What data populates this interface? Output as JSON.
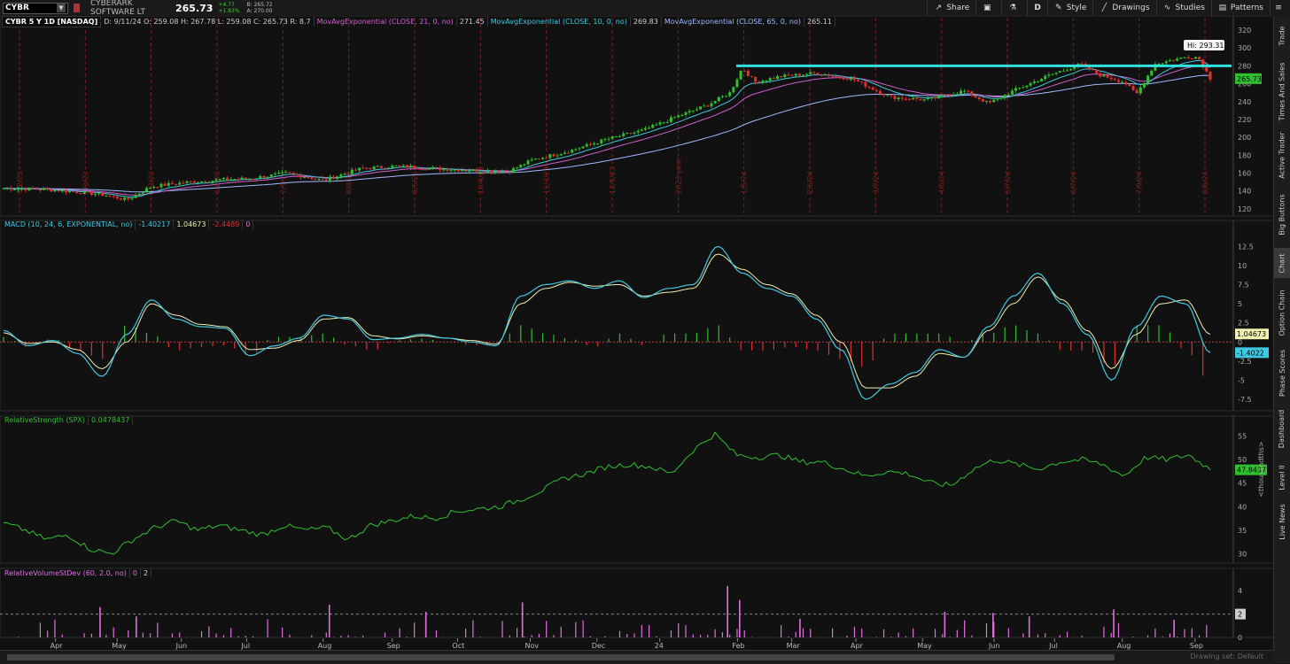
{
  "toolbar": {
    "symbol": "CYBR",
    "company": "CYBERARK SOFTWARE LT",
    "last": "265.73",
    "change_abs": "+4.77",
    "change_pct": "+1.83%",
    "bid": "B: 265.72",
    "ask": "A: 270.00",
    "buttons": [
      {
        "label": "Share",
        "icon": "share-icon"
      },
      {
        "label": "",
        "icon": "clipboard-icon"
      },
      {
        "label": "",
        "icon": "flask-icon"
      },
      {
        "label": "D",
        "icon": ""
      },
      {
        "label": "Style",
        "icon": "gear-icon"
      },
      {
        "label": "Drawings",
        "icon": "pencil-icon"
      },
      {
        "label": "Studies",
        "icon": "studies-icon"
      },
      {
        "label": "Patterns",
        "icon": "patterns-icon"
      }
    ]
  },
  "price_legend": {
    "title": "CYBR 5 Y 1D [NASDAQ]",
    "ohlc": "D: 9/11/24  O: 259.08  H: 267.78  L: 259.08  C: 265.73  R: 8.7",
    "ema21": "MovAvgExponential (CLOSE, 21, 0, no)",
    "ema21_val": "271.45",
    "ema10": "MovAvgExponential (CLOSE, 10, 0, no)",
    "ema10_val": "269.83",
    "ema65": "MovAvgExponential (CLOSE, 65, 0, no)",
    "ema65_val": "265.11"
  },
  "macd_legend": {
    "title": "MACD (10, 24, 6, EXPONENTIAL, no)",
    "v1": "-1.40217",
    "v2": "1.04673",
    "v3": "-2.4489",
    "v4": "0"
  },
  "rs_legend": {
    "title": "RelativeStrength (SPX)",
    "v1": "0.0478437"
  },
  "rv_legend": {
    "title": "RelativeVolumeStDev (60, 2.0, no)",
    "v1": "0",
    "v2": "2"
  },
  "sidebar_tabs": [
    "Trade",
    "Times And Sales",
    "Active Trader",
    "Big Buttons",
    "Chart",
    "Option Chain",
    "Phase Scores",
    "Dashboard",
    "Level II",
    "Live News"
  ],
  "active_tab": "Chart",
  "bottom": {
    "drawing_set": "Drawing set: Default"
  },
  "colors": {
    "up": "#2fbf2f",
    "down": "#e03030",
    "ema21": "#d060d0",
    "ema10": "#40c8e0",
    "ema65": "#a0b8ff",
    "resistance": "#33e0e0",
    "macd": "#40c8e0",
    "signal": "#f0f0b0",
    "rs": "#2fbf2f",
    "rv": "#e070e0"
  },
  "chart_data": [
    {
      "type": "candlestick",
      "title": "CYBR 5 Y 1D [NASDAQ]",
      "y_ticks": [
        120,
        140,
        160,
        180,
        200,
        220,
        240,
        260,
        280,
        300,
        320
      ],
      "ylim": [
        112,
        324
      ],
      "x_months": [
        "Apr",
        "May",
        "Jun",
        "Jul",
        "Aug",
        "Sep",
        "Oct",
        "Nov",
        "Dec",
        "24",
        "Feb",
        "Mar",
        "Apr",
        "May",
        "Jun",
        "Jul",
        "Aug",
        "Sep"
      ],
      "x_month_positions": [
        0.045,
        0.095,
        0.147,
        0.2,
        0.262,
        0.318,
        0.371,
        0.43,
        0.484,
        0.535,
        0.598,
        0.642,
        0.694,
        0.748,
        0.806,
        0.855,
        0.91,
        0.969
      ],
      "rotated_dates": [
        "3/2/23",
        "4/3/23",
        "5/3/23",
        "6/2/23",
        "7/5/23",
        "8/3/23",
        "9/5/23",
        "10/4/23",
        "11/3/23",
        "12/5/23",
        "2023 year",
        "1/5/24",
        "2/6/24",
        "3/7/24",
        "4/5/24",
        "5/7/24",
        "6/7/24",
        "7/9/24",
        "8/8/24"
      ],
      "close_path": [
        [
          0,
          143
        ],
        [
          0.03,
          142
        ],
        [
          0.06,
          139
        ],
        [
          0.08,
          136
        ],
        [
          0.1,
          130
        ],
        [
          0.12,
          145
        ],
        [
          0.15,
          150
        ],
        [
          0.18,
          153
        ],
        [
          0.2,
          154
        ],
        [
          0.23,
          160
        ],
        [
          0.26,
          152
        ],
        [
          0.29,
          165
        ],
        [
          0.32,
          168
        ],
        [
          0.35,
          165
        ],
        [
          0.38,
          163
        ],
        [
          0.41,
          162
        ],
        [
          0.43,
          175
        ],
        [
          0.46,
          185
        ],
        [
          0.49,
          198
        ],
        [
          0.52,
          208
        ],
        [
          0.55,
          225
        ],
        [
          0.57,
          235
        ],
        [
          0.59,
          250
        ],
        [
          0.6,
          278
        ],
        [
          0.61,
          262
        ],
        [
          0.63,
          268
        ],
        [
          0.66,
          272
        ],
        [
          0.69,
          265
        ],
        [
          0.72,
          245
        ],
        [
          0.75,
          242
        ],
        [
          0.78,
          252
        ],
        [
          0.8,
          238
        ],
        [
          0.82,
          252
        ],
        [
          0.85,
          270
        ],
        [
          0.875,
          282
        ],
        [
          0.89,
          270
        ],
        [
          0.91,
          262
        ],
        [
          0.92,
          248
        ],
        [
          0.935,
          282
        ],
        [
          0.96,
          290
        ],
        [
          0.97,
          290
        ],
        [
          0.98,
          266
        ]
      ],
      "hi_label": "Hi: 293.31",
      "resistance": 280,
      "last_label": "265.73"
    },
    {
      "type": "line",
      "title": "MACD (10, 24, 6, EXPONENTIAL, no)",
      "y_ticks": [
        "12.5",
        "10",
        "7.5",
        "5",
        "2.5",
        "0",
        "-2.5",
        "-5",
        "-7.5"
      ],
      "series": [
        {
          "name": "MACD",
          "values": [
            1.5,
            -0.5,
            0.2,
            -1.5,
            -4.5,
            1,
            5.5,
            3,
            2,
            1.8,
            -1.8,
            -0.5,
            0.5,
            3.5,
            3,
            0.3,
            0.5,
            1,
            0.5,
            0,
            -0.5,
            6,
            7.5,
            8,
            7,
            8,
            5.8,
            7,
            7.5,
            12.5,
            9,
            7,
            6,
            3,
            -1,
            -7.5,
            -5.5,
            -4,
            -1,
            -2,
            2,
            6,
            9,
            5,
            1,
            -5,
            2,
            6,
            5,
            -1.4
          ]
        },
        {
          "name": "Signal",
          "values": [
            1.2,
            -0.2,
            0,
            -1,
            -3.5,
            0,
            5,
            3.5,
            2.3,
            2,
            -1,
            -0.8,
            0.2,
            3,
            3.2,
            0.8,
            0.4,
            0.8,
            0.5,
            0.2,
            -0.3,
            5,
            7,
            7.8,
            7.3,
            7.5,
            6,
            6.5,
            7,
            11.5,
            9.5,
            7.5,
            6.3,
            3.5,
            0,
            -6,
            -6,
            -4.5,
            -1.5,
            -2,
            1.5,
            5,
            8.5,
            5.5,
            1.5,
            -3.5,
            1,
            5,
            5.5,
            1.0
          ]
        }
      ],
      "last_values": [
        "1.04673",
        "-1.4022"
      ]
    },
    {
      "type": "line",
      "title": "RelativeStrength (SPX)",
      "y_ticks": [
        30,
        35,
        40,
        45,
        50,
        55
      ],
      "y_unit": "<thousandths>",
      "series": [
        {
          "name": "RelativeStrength (SPX)",
          "values": [
            36.5,
            35,
            33,
            34,
            31,
            30,
            33,
            35.5,
            37,
            35,
            36,
            35,
            34,
            36,
            35,
            35.5,
            33,
            36,
            37,
            38,
            37.5,
            39,
            39.5,
            40,
            41.5,
            43.5,
            46,
            47,
            48.5,
            49,
            48.5,
            47,
            52,
            55.5,
            51,
            50.5,
            51,
            49.5,
            49.5,
            48,
            46.5,
            47.5,
            47,
            45,
            44.5,
            48,
            50,
            49,
            48,
            49.5,
            50,
            49,
            46.5,
            50.5,
            50,
            51,
            48
          ]
        }
      ],
      "last_value": "47.8437"
    },
    {
      "type": "bar",
      "title": "RelativeVolumeStDev (60, 2.0, no)",
      "y_ticks": [
        0,
        2,
        4
      ],
      "last_value": "2",
      "spikes": [
        [
          0.08,
          2.6
        ],
        [
          0.11,
          1.8
        ],
        [
          0.27,
          2.8
        ],
        [
          0.35,
          2.2
        ],
        [
          0.43,
          3.0
        ],
        [
          0.6,
          4.4
        ],
        [
          0.61,
          3.2
        ],
        [
          0.66,
          1.6
        ],
        [
          0.78,
          2.2
        ],
        [
          0.82,
          2.1
        ],
        [
          0.85,
          1.8
        ],
        [
          0.92,
          2.4
        ],
        [
          0.97,
          1.5
        ]
      ]
    }
  ]
}
